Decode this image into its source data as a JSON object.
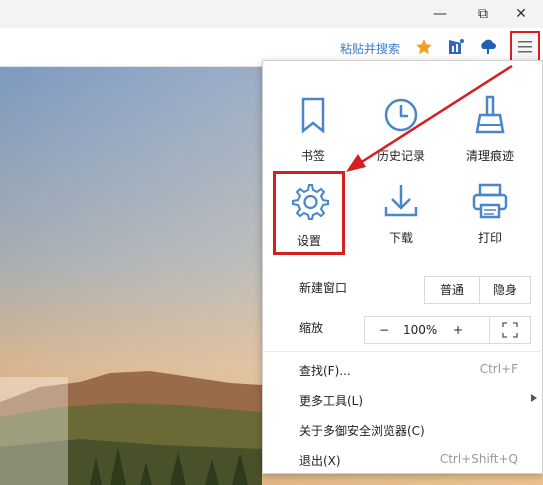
{
  "window": {
    "minimize": "—",
    "restore": "⧉",
    "close": "✕"
  },
  "toolbar": {
    "paste_search": "粘贴并搜索",
    "icons": [
      "star-icon",
      "bar-chart-icon",
      "upload-cloud-icon",
      "menu-icon"
    ]
  },
  "menu": {
    "tiles_row1": [
      {
        "label": "书签",
        "icon": "bookmark-icon"
      },
      {
        "label": "历史记录",
        "icon": "clock-icon"
      },
      {
        "label": "清理痕迹",
        "icon": "broom-icon"
      }
    ],
    "tiles_row2": [
      {
        "label": "设置",
        "icon": "gear-icon"
      },
      {
        "label": "下载",
        "icon": "download-icon"
      },
      {
        "label": "打印",
        "icon": "printer-icon"
      }
    ],
    "new_window": {
      "label": "新建窗口",
      "normal": "普通",
      "incognito": "隐身"
    },
    "zoom": {
      "label": "缩放",
      "minus": "−",
      "value": "100%",
      "plus": "+"
    },
    "find": {
      "label": "查找(F)...",
      "shortcut": "Ctrl+F"
    },
    "more_tools": {
      "label": "更多工具(L)"
    },
    "about": {
      "label": "关于多御安全浏览器(C)"
    },
    "exit": {
      "label": "退出(X)",
      "shortcut": "Ctrl+Shift+Q"
    }
  },
  "colors": {
    "accent": "#3b7bd0",
    "highlight": "#d42020",
    "icon": "#4a86c8"
  }
}
